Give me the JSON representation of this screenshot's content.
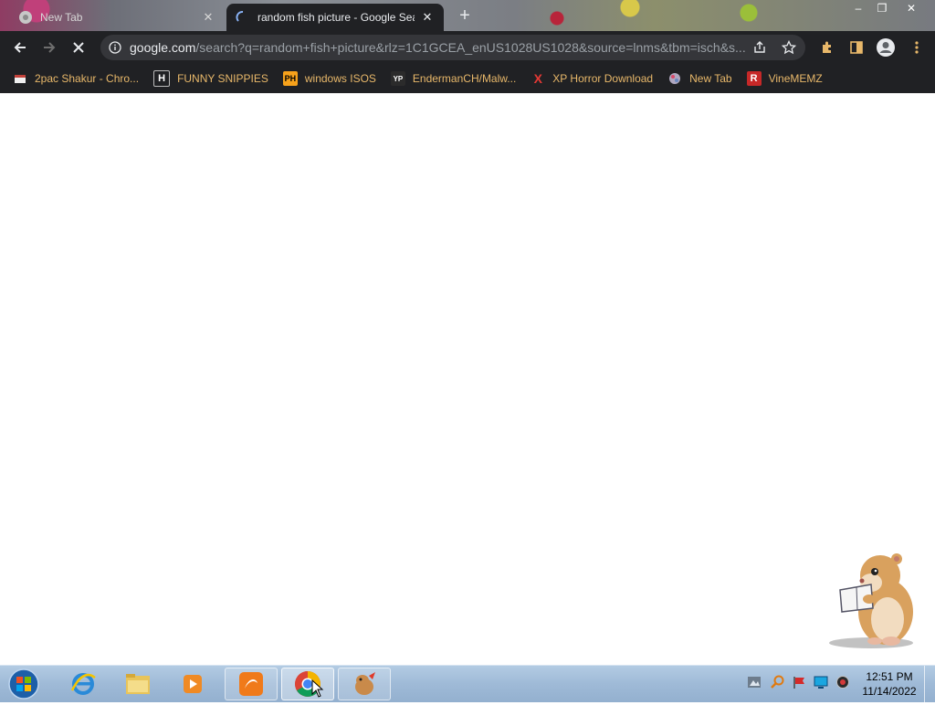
{
  "browser": {
    "tabs": [
      {
        "title": "New Tab",
        "active": false
      },
      {
        "title": "random fish picture - Google Search",
        "active": true,
        "loading": true
      }
    ],
    "window_controls": {
      "minimize": "–",
      "maximize": "❐",
      "close": "✕"
    },
    "address": {
      "host": "google.com",
      "path": "/search?q=random+fish+picture&rlz=1C1GCEA_enUS1028US1028&source=lnms&tbm=isch&s..."
    },
    "bookmarks": [
      {
        "label": "2pac Shakur - Chro...",
        "icon": "book-icon",
        "icon_text": ""
      },
      {
        "label": "FUNNY SNIPPIES",
        "icon": "h-letter-icon",
        "icon_text": "H"
      },
      {
        "label": "windows ISOS",
        "icon": "ph-icon",
        "icon_text": "PH"
      },
      {
        "label": "EndermanCH/Malw...",
        "icon": "yp-icon",
        "icon_text": "YP"
      },
      {
        "label": "XP Horror Download",
        "icon": "x-letter-icon",
        "icon_text": "X"
      },
      {
        "label": "New Tab",
        "icon": "globe-icon",
        "icon_text": ""
      },
      {
        "label": "VineMEMZ",
        "icon": "r-letter-icon",
        "icon_text": "R"
      }
    ]
  },
  "taskbar": {
    "clock_time": "12:51 PM",
    "clock_date": "11/14/2022"
  },
  "colors": {
    "chrome_dark": "#202124",
    "omnibox": "#35363a",
    "bookmark_text": "#e8b86a",
    "taskbar": "#9fbad7"
  }
}
